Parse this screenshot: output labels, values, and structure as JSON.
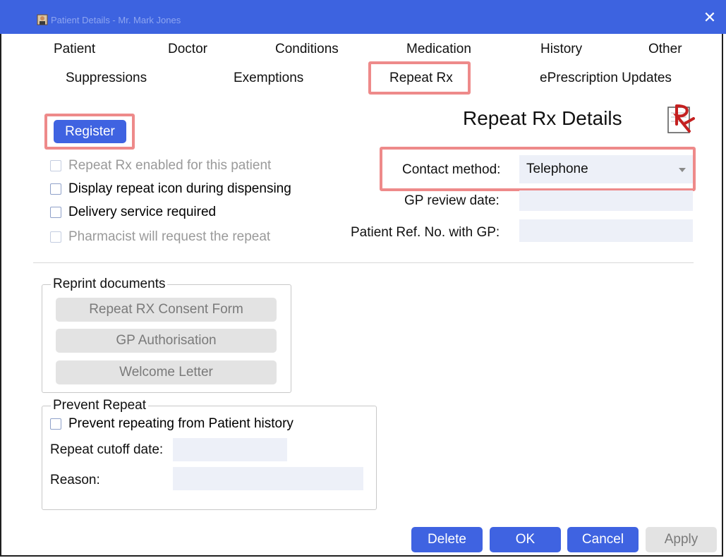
{
  "window": {
    "title": "Patient Details - Mr. Mark Jones",
    "close_glyph": "✕"
  },
  "tabs": {
    "row1": [
      "Patient",
      "Doctor",
      "Conditions",
      "Medication",
      "History",
      "Other"
    ],
    "row2": [
      "Suppressions",
      "Exemptions",
      "Repeat Rx",
      "ePrescription Updates"
    ],
    "active": "Repeat Rx"
  },
  "heading": "Repeat Rx Details",
  "register_button": "Register",
  "checkboxes": [
    {
      "label": "Repeat Rx enabled for this patient",
      "checked": false,
      "enabled": false
    },
    {
      "label": "Display repeat icon during dispensing",
      "checked": false,
      "enabled": true
    },
    {
      "label": "Delivery service required",
      "checked": false,
      "enabled": true
    },
    {
      "label": "Pharmacist will request the repeat",
      "checked": false,
      "enabled": false
    }
  ],
  "contact": {
    "label": "Contact method:",
    "value": "Telephone"
  },
  "gp_review": {
    "label": "GP review date:",
    "value": ""
  },
  "patient_ref": {
    "label": "Patient Ref. No. with GP:",
    "value": ""
  },
  "reprint": {
    "legend": "Reprint documents",
    "buttons": [
      "Repeat RX Consent Form",
      "GP Authorisation",
      "Welcome Letter"
    ]
  },
  "prevent": {
    "legend": "Prevent Repeat",
    "checkbox_label": "Prevent repeating from Patient history",
    "cutoff_label": "Repeat cutoff date:",
    "cutoff_value": "",
    "reason_label": "Reason:",
    "reason_value": ""
  },
  "footer": {
    "delete": "Delete",
    "ok": "OK",
    "cancel": "Cancel",
    "apply": "Apply"
  },
  "colors": {
    "titlebar": "#3d63e0",
    "button_blue": "#3f63e1",
    "highlight": "#ee8a8a",
    "field_bg": "#edf0f8"
  }
}
